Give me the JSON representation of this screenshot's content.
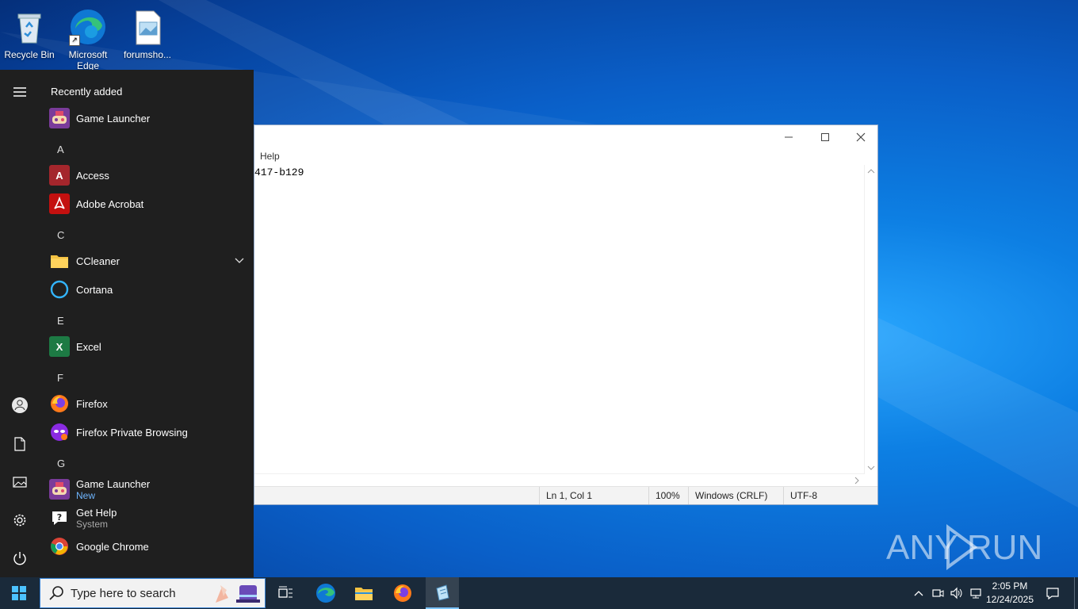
{
  "desktop": {
    "icons": [
      {
        "label": "Recycle Bin",
        "icon": "recycle-bin-icon"
      },
      {
        "label": "Microsoft Edge",
        "icon": "edge-icon"
      },
      {
        "label": "forumsho...",
        "icon": "image-file-icon"
      }
    ]
  },
  "notepad": {
    "menu_help": "Help",
    "content": "417-b129",
    "status": {
      "position": "Ln 1, Col 1",
      "zoom": "100%",
      "line_ending": "Windows (CRLF)",
      "encoding": "UTF-8"
    }
  },
  "start_menu": {
    "recently_added_label": "Recently added",
    "recent_app": "Game Launcher",
    "letters": {
      "a": "A",
      "c": "C",
      "e": "E",
      "f": "F",
      "g": "G"
    },
    "apps": {
      "access": "Access",
      "acrobat": "Adobe Acrobat",
      "ccleaner": "CCleaner",
      "cortana": "Cortana",
      "excel": "Excel",
      "firefox": "Firefox",
      "firefox_private": "Firefox Private Browsing",
      "game_launcher": "Game Launcher",
      "game_launcher_badge": "New",
      "get_help": "Get Help",
      "get_help_sub": "System",
      "chrome": "Google Chrome"
    }
  },
  "taskbar": {
    "search_placeholder": "Type here to search",
    "clock_time": "2:05 PM",
    "clock_date": "12/24/2025"
  },
  "watermark": "ANY RUN",
  "colors": {
    "accent": "#0078d4",
    "start_bg": "#1f1f1f",
    "taskbar_bg": "#1a2a3a"
  }
}
